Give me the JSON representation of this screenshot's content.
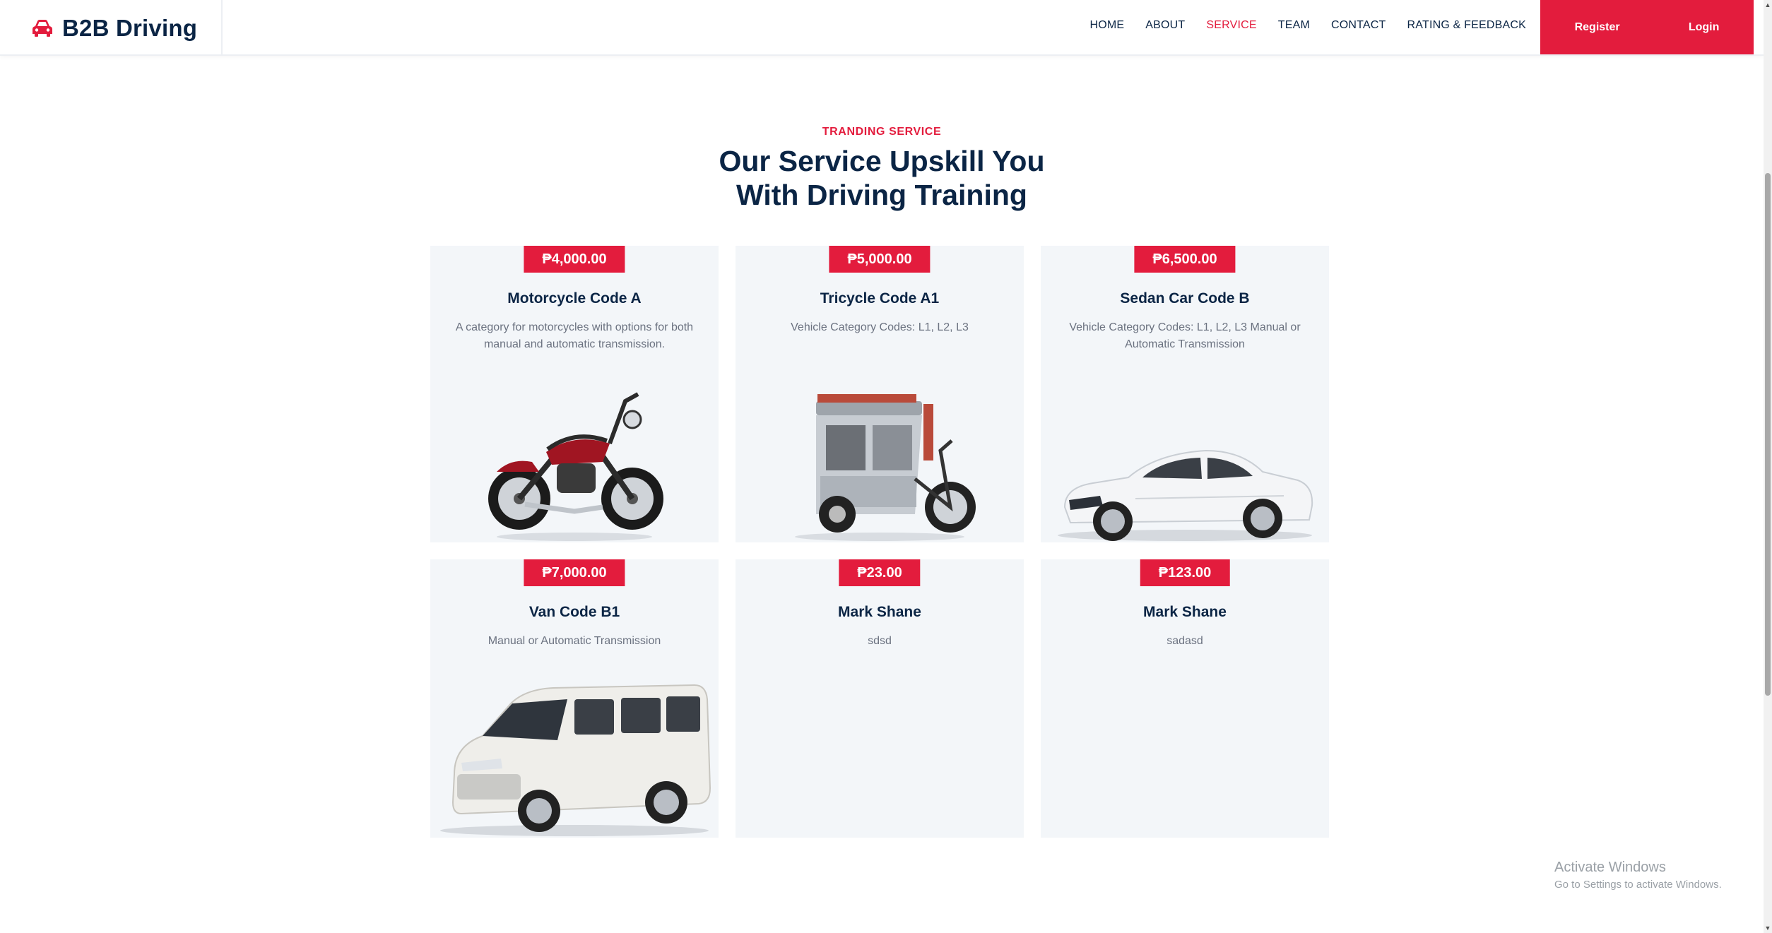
{
  "brand": {
    "name": "B2B Driving",
    "icon": "car-icon",
    "accent": "#e31c3d",
    "text_color": "#0b2545"
  },
  "nav": {
    "items": [
      {
        "label": "HOME",
        "active": false
      },
      {
        "label": "ABOUT",
        "active": false
      },
      {
        "label": "SERVICE",
        "active": true
      },
      {
        "label": "TEAM",
        "active": false
      },
      {
        "label": "CONTACT",
        "active": false
      },
      {
        "label": "RATING & FEEDBACK",
        "active": false
      }
    ],
    "register_label": "Register",
    "login_label": "Login"
  },
  "section": {
    "eyebrow": "TRANDING SERVICE",
    "heading_line1": "Our Service Upskill You",
    "heading_line2": "With Driving Training"
  },
  "services": [
    {
      "price": "₱4,000.00",
      "title": "Motorcycle Code A",
      "description": "A category for motorcycles with options for both manual and automatic transmission.",
      "image": "motorcycle"
    },
    {
      "price": "₱5,000.00",
      "title": "Tricycle Code A1",
      "description": "Vehicle Category Codes: L1, L2, L3",
      "image": "tricycle"
    },
    {
      "price": "₱6,500.00",
      "title": "Sedan Car Code B",
      "description": "Vehicle Category Codes: L1, L2, L3 Manual or Automatic Transmission",
      "image": "sedan"
    },
    {
      "price": "₱7,000.00",
      "title": "Van Code B1",
      "description": "Manual or Automatic Transmission",
      "image": "van"
    },
    {
      "price": "₱23.00",
      "title": "Mark Shane",
      "description": "sdsd",
      "image": ""
    },
    {
      "price": "₱123.00",
      "title": "Mark Shane",
      "description": "sadasd",
      "image": ""
    }
  ],
  "watermark": {
    "title": "Activate Windows",
    "subtitle": "Go to Settings to activate Windows."
  }
}
